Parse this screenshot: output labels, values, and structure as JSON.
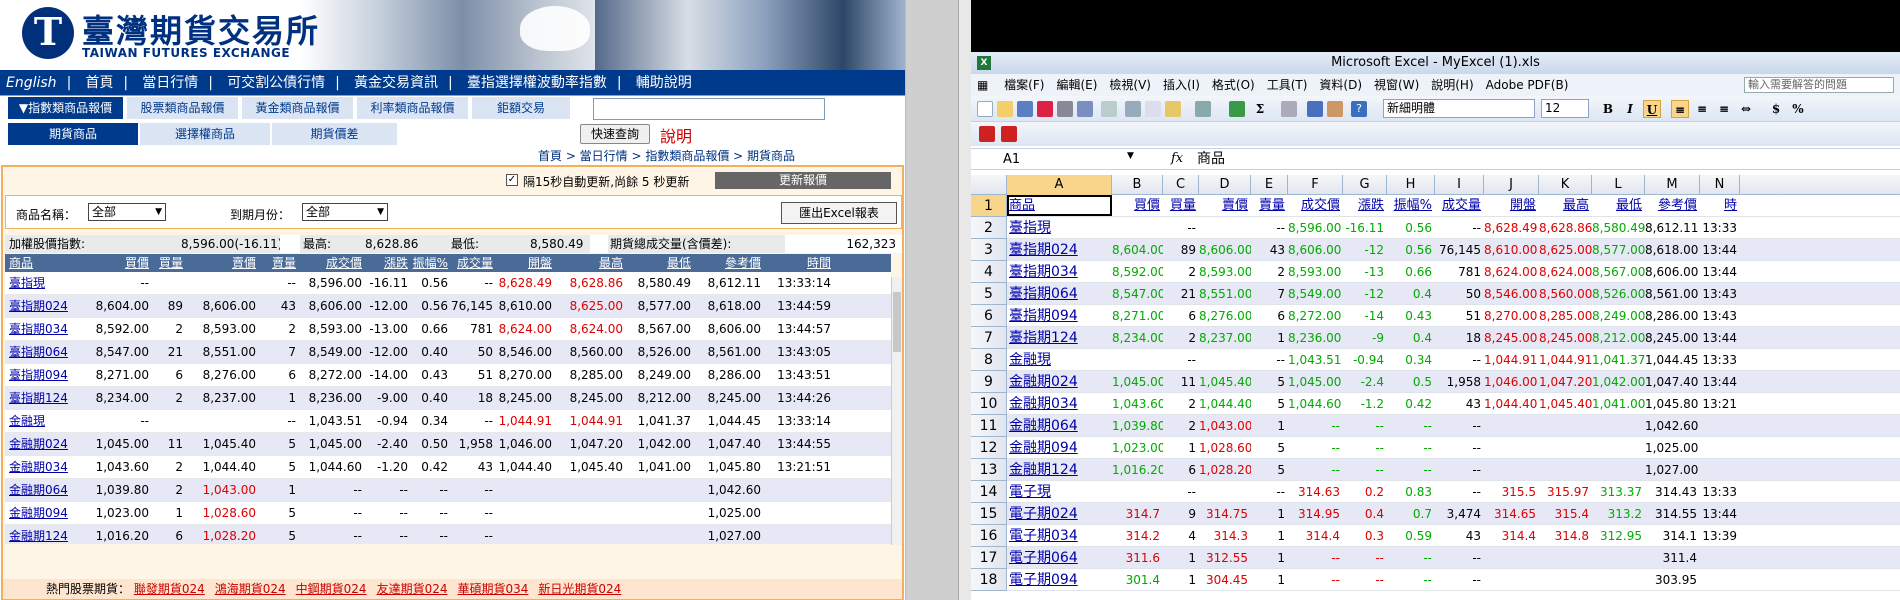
{
  "taifex": {
    "logo_cn": "臺灣期貨交易所",
    "logo_en": "TAIWAN FUTURES EXCHANGE",
    "nav_main": [
      "English",
      "首頁",
      "當日行情",
      "可交割公債行情",
      "黃金交易資訊",
      "臺指選擇權波動率指數",
      "輔助說明"
    ],
    "nav_cats": [
      "▼指數類商品報價",
      "股票類商品報價",
      "黃金類商品報價",
      "利率類商品報價",
      "鉅額交易"
    ],
    "nav_sub": [
      "期貨商品",
      "選擇權商品",
      "期貨價差"
    ],
    "quick_query": "快速查詢",
    "help": "說明",
    "breadcrumb": "首頁 > 當日行情 > 指數類商品報價 > 期貨商品",
    "auto_refresh": "隔15秒自動更新,尚餘 5 秒更新",
    "update_btn": "更新報價",
    "filter_name_label": "商品名稱：",
    "filter_name_value": "全部",
    "filter_month_label": "到期月份：",
    "filter_month_value": "全部",
    "excel_btn": "匯出Excel報表",
    "index": {
      "label": "加權股價指數:",
      "value": "8,596.00(-16.11)",
      "high_label": "最高:",
      "high": "8,628.86",
      "low_label": "最低:",
      "low": "8,580.49",
      "volume_label": "期貨總成交量(含價差):",
      "volume": "162,323"
    },
    "columns": [
      "商品",
      "買價",
      "買量",
      "賣價",
      "賣量",
      "成交價",
      "漲跌",
      "振幅%",
      "成交量",
      "開盤",
      "最高",
      "最低",
      "參考價",
      "時間"
    ],
    "rows": [
      {
        "name": "臺指現",
        "bid": "--",
        "bq": "",
        "ask": "",
        "aq": "--",
        "last": "8,596.00",
        "chg": "-16.11",
        "amp": "0.56",
        "vol": "--",
        "open": "8,628.49",
        "high": "8,628.86",
        "low": "8,580.49",
        "ref": "8,612.11",
        "time": "13:33:14",
        "o_up": true
      },
      {
        "name": "臺指期024",
        "bid": "8,604.00",
        "bq": "89",
        "ask": "8,606.00",
        "aq": "43",
        "last": "8,606.00",
        "chg": "-12.00",
        "amp": "0.56",
        "vol": "76,145",
        "open": "8,610.00",
        "high": "8,625.00",
        "low": "8,577.00",
        "ref": "8,618.00",
        "time": "13:44:59",
        "h_up": true
      },
      {
        "name": "臺指期034",
        "bid": "8,592.00",
        "bq": "2",
        "ask": "8,593.00",
        "aq": "2",
        "last": "8,593.00",
        "chg": "-13.00",
        "amp": "0.66",
        "vol": "781",
        "open": "8,624.00",
        "high": "8,624.00",
        "low": "8,567.00",
        "ref": "8,606.00",
        "time": "13:44:57",
        "o_up": true
      },
      {
        "name": "臺指期064",
        "bid": "8,547.00",
        "bq": "21",
        "ask": "8,551.00",
        "aq": "7",
        "last": "8,549.00",
        "chg": "-12.00",
        "amp": "0.40",
        "vol": "50",
        "open": "8,546.00",
        "high": "8,560.00",
        "low": "8,526.00",
        "ref": "8,561.00",
        "time": "13:43:05"
      },
      {
        "name": "臺指期094",
        "bid": "8,271.00",
        "bq": "6",
        "ask": "8,276.00",
        "aq": "6",
        "last": "8,272.00",
        "chg": "-14.00",
        "amp": "0.43",
        "vol": "51",
        "open": "8,270.00",
        "high": "8,285.00",
        "low": "8,249.00",
        "ref": "8,286.00",
        "time": "13:43:51"
      },
      {
        "name": "臺指期124",
        "bid": "8,234.00",
        "bq": "2",
        "ask": "8,237.00",
        "aq": "1",
        "last": "8,236.00",
        "chg": "-9.00",
        "amp": "0.40",
        "vol": "18",
        "open": "8,245.00",
        "high": "8,245.00",
        "low": "8,212.00",
        "ref": "8,245.00",
        "time": "13:44:26",
        "o_flat": true
      },
      {
        "name": "金融現",
        "bid": "--",
        "bq": "",
        "ask": "",
        "aq": "--",
        "last": "1,043.51",
        "chg": "-0.94",
        "amp": "0.34",
        "vol": "--",
        "open": "1,044.91",
        "high": "1,044.91",
        "low": "1,041.37",
        "ref": "1,044.45",
        "time": "13:33:14",
        "o_up": true
      },
      {
        "name": "金融期024",
        "bid": "1,045.00",
        "bq": "11",
        "ask": "1,045.40",
        "aq": "5",
        "last": "1,045.00",
        "chg": "-2.40",
        "amp": "0.50",
        "vol": "1,958",
        "open": "1,046.00",
        "high": "1,047.20",
        "low": "1,042.00",
        "ref": "1,047.40",
        "time": "13:44:55"
      },
      {
        "name": "金融期034",
        "bid": "1,043.60",
        "bq": "2",
        "ask": "1,044.40",
        "aq": "5",
        "last": "1,044.60",
        "chg": "-1.20",
        "amp": "0.42",
        "vol": "43",
        "open": "1,044.40",
        "high": "1,045.40",
        "low": "1,041.00",
        "ref": "1,045.80",
        "time": "13:21:51"
      },
      {
        "name": "金融期064",
        "bid": "1,039.80",
        "bq": "2",
        "ask": "1,043.00",
        "aq": "1",
        "last": "--",
        "chg": "--",
        "amp": "--",
        "vol": "--",
        "open": "",
        "high": "",
        "low": "",
        "ref": "1,042.60",
        "time": "",
        "a_up": true
      },
      {
        "name": "金融期094",
        "bid": "1,023.00",
        "bq": "1",
        "ask": "1,028.60",
        "aq": "5",
        "last": "--",
        "chg": "--",
        "amp": "--",
        "vol": "--",
        "open": "",
        "high": "",
        "low": "",
        "ref": "1,025.00",
        "time": "",
        "a_up": true
      },
      {
        "name": "金融期124",
        "bid": "1,016.20",
        "bq": "6",
        "ask": "1,028.20",
        "aq": "5",
        "last": "--",
        "chg": "--",
        "amp": "--",
        "vol": "--",
        "open": "",
        "high": "",
        "low": "",
        "ref": "1,027.00",
        "time": "",
        "a_up": true
      }
    ],
    "hot_label": "熱門股票期貨：",
    "hot_links": [
      "聯發期貨024",
      "鴻海期貨024",
      "中鋼期貨024",
      "友達期貨024",
      "華碩期貨034",
      "新日光期貨024"
    ]
  },
  "excel": {
    "title": "Microsoft Excel - MyExcel (1).xls",
    "menu": [
      "檔案(F)",
      "編輯(E)",
      "檢視(V)",
      "插入(I)",
      "格式(O)",
      "工具(T)",
      "資料(D)",
      "視窗(W)",
      "說明(H)",
      "Adobe PDF(B)"
    ],
    "ask_placeholder": "輸入需要解答的問題",
    "font_name": "新細明體",
    "font_size": "12",
    "name_box": "A1",
    "formula": "商品",
    "col_letters": [
      "A",
      "B",
      "C",
      "D",
      "E",
      "F",
      "G",
      "H",
      "I",
      "J",
      "K",
      "L",
      "M",
      "N"
    ],
    "header": [
      "商品",
      "買價",
      "買量",
      "賣價",
      "賣量",
      "成交價",
      "漲跌",
      "振幅%",
      "成交量",
      "開盤",
      "最高",
      "最低",
      "參考價",
      "時"
    ],
    "rows": [
      [
        "臺指現",
        "",
        "--",
        "",
        "--",
        "8,596.00",
        "-16.11",
        "0.56",
        "--",
        "8,628.49",
        "8,628.86",
        "8,580.49",
        "8,612.11",
        "13:33"
      ],
      [
        "臺指期024",
        "8,604.00",
        "89",
        "8,606.00",
        "43",
        "8,606.00",
        "-12",
        "0.56",
        "76,145",
        "8,610.00",
        "8,625.00",
        "8,577.00",
        "8,618.00",
        "13:44"
      ],
      [
        "臺指期034",
        "8,592.00",
        "2",
        "8,593.00",
        "2",
        "8,593.00",
        "-13",
        "0.66",
        "781",
        "8,624.00",
        "8,624.00",
        "8,567.00",
        "8,606.00",
        "13:44"
      ],
      [
        "臺指期064",
        "8,547.00",
        "21",
        "8,551.00",
        "7",
        "8,549.00",
        "-12",
        "0.4",
        "50",
        "8,546.00",
        "8,560.00",
        "8,526.00",
        "8,561.00",
        "13:43"
      ],
      [
        "臺指期094",
        "8,271.00",
        "6",
        "8,276.00",
        "6",
        "8,272.00",
        "-14",
        "0.43",
        "51",
        "8,270.00",
        "8,285.00",
        "8,249.00",
        "8,286.00",
        "13:43"
      ],
      [
        "臺指期124",
        "8,234.00",
        "2",
        "8,237.00",
        "1",
        "8,236.00",
        "-9",
        "0.4",
        "18",
        "8,245.00",
        "8,245.00",
        "8,212.00",
        "8,245.00",
        "13:44"
      ],
      [
        "金融現",
        "",
        "--",
        "",
        "--",
        "1,043.51",
        "-0.94",
        "0.34",
        "--",
        "1,044.91",
        "1,044.91",
        "1,041.37",
        "1,044.45",
        "13:33"
      ],
      [
        "金融期024",
        "1,045.00",
        "11",
        "1,045.40",
        "5",
        "1,045.00",
        "-2.4",
        "0.5",
        "1,958",
        "1,046.00",
        "1,047.20",
        "1,042.00",
        "1,047.40",
        "13:44"
      ],
      [
        "金融期034",
        "1,043.60",
        "2",
        "1,044.40",
        "5",
        "1,044.60",
        "-1.2",
        "0.42",
        "43",
        "1,044.40",
        "1,045.40",
        "1,041.00",
        "1,045.80",
        "13:21"
      ],
      [
        "金融期064",
        "1,039.80",
        "2",
        "1,043.00",
        "1",
        "--",
        "--",
        "--",
        "--",
        "",
        "",
        "",
        "1,042.60",
        ""
      ],
      [
        "金融期094",
        "1,023.00",
        "1",
        "1,028.60",
        "5",
        "--",
        "--",
        "--",
        "--",
        "",
        "",
        "",
        "1,025.00",
        ""
      ],
      [
        "金融期124",
        "1,016.20",
        "6",
        "1,028.20",
        "5",
        "--",
        "--",
        "--",
        "--",
        "",
        "",
        "",
        "1,027.00",
        ""
      ],
      [
        "電子現",
        "",
        "--",
        "",
        "--",
        "314.63",
        "0.2",
        "0.83",
        "--",
        "315.5",
        "315.97",
        "313.37",
        "314.43",
        "13:33"
      ],
      [
        "電子期024",
        "314.7",
        "9",
        "314.75",
        "1",
        "314.95",
        "0.4",
        "0.7",
        "3,474",
        "314.65",
        "315.4",
        "313.2",
        "314.55",
        "13:44"
      ],
      [
        "電子期034",
        "314.2",
        "4",
        "314.3",
        "1",
        "314.4",
        "0.3",
        "0.59",
        "43",
        "314.4",
        "314.8",
        "312.95",
        "314.1",
        "13:39"
      ],
      [
        "電子期064",
        "311.6",
        "1",
        "312.55",
        "1",
        "--",
        "--",
        "--",
        "--",
        "",
        "",
        "",
        "311.4",
        ""
      ],
      [
        "電子期094",
        "301.4",
        "1",
        "304.45",
        "1",
        "--",
        "--",
        "--",
        "--",
        "",
        "",
        "",
        "303.95",
        ""
      ]
    ]
  }
}
